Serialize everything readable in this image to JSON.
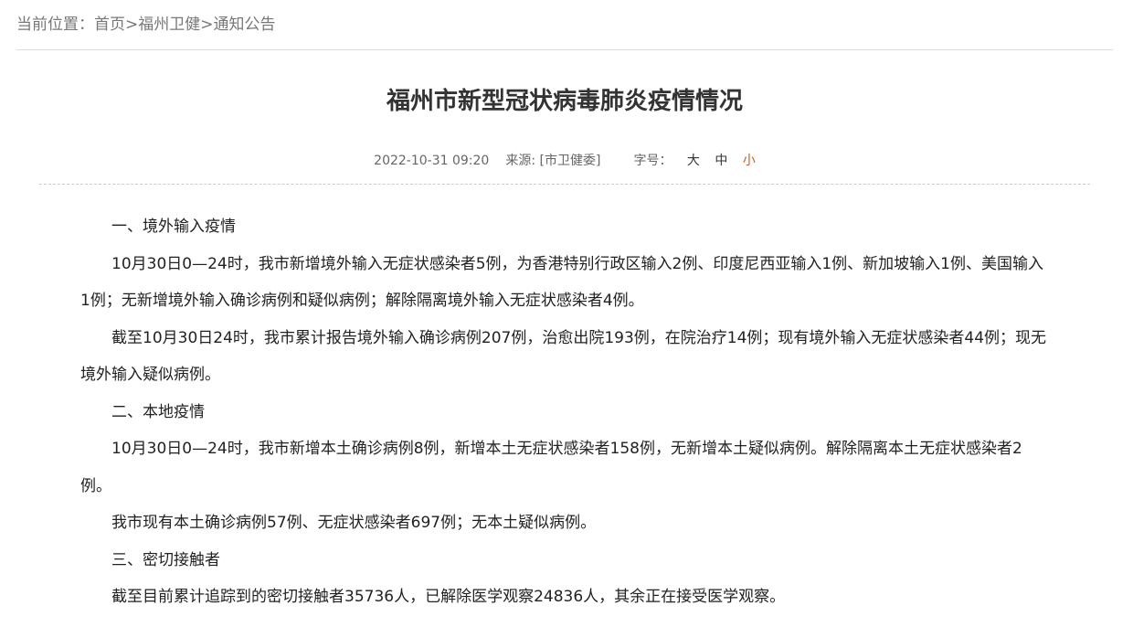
{
  "breadcrumb": {
    "prefix": "当前位置：",
    "items": [
      "首页",
      "福州卫健",
      "通知公告"
    ],
    "separator": ">"
  },
  "article": {
    "title": "福州市新型冠状病毒肺炎疫情情况",
    "date": "2022-10-31 09:20",
    "source_label": "来源:",
    "source": "[市卫健委]",
    "font_size_label": "字号：",
    "font_sizes": [
      "大",
      "中",
      "小"
    ],
    "active_font_size": "小",
    "accent_color": "#d9541e",
    "paragraphs": [
      "一、境外输入疫情",
      "10月30日0—24时，我市新增境外输入无症状感染者5例，为香港特别行政区输入2例、印度尼西亚输入1例、新加坡输入1例、美国输入1例；无新增境外输入确诊病例和疑似病例；解除隔离境外输入无症状感染者4例。",
      "截至10月30日24时，我市累计报告境外输入确诊病例207例，治愈出院193例，在院治疗14例；现有境外输入无症状感染者44例；现无境外输入疑似病例。",
      "二、本地疫情",
      "10月30日0—24时，我市新增本土确诊病例8例，新增本土无症状感染者158例，无新增本土疑似病例。解除隔离本土无症状感染者2例。",
      "我市现有本土确诊病例57例、无症状感染者697例；无本土疑似病例。",
      "三、密切接触者",
      "截至目前累计追踪到的密切接触者35736人，已解除医学观察24836人，其余正在接受医学观察。"
    ]
  }
}
